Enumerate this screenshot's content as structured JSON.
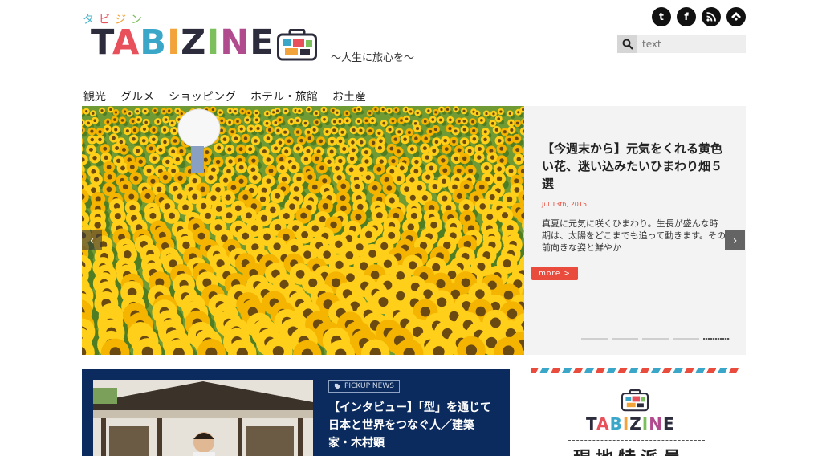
{
  "logo": {
    "kana": [
      "タ",
      "ビ",
      "ジ",
      "ン"
    ],
    "word": [
      "T",
      "A",
      "B",
      "I",
      "Z",
      "I",
      "N",
      "E"
    ],
    "tagline": "〜人生に旅心を〜"
  },
  "social": {
    "twitter_glyph": "t",
    "facebook_glyph": "f",
    "rss_glyph": "r",
    "feedly_glyph": "f"
  },
  "search": {
    "placeholder": "text"
  },
  "nav": [
    "観光",
    "グルメ",
    "ショッピング",
    "ホテル・旅館",
    "お土産"
  ],
  "slider": {
    "title": "【今週末から】元気をくれる黄色い花、迷い込みたいひまわり畑５選",
    "date": "Jul 13th, 2015",
    "excerpt": "真夏に元気に咲くひまわり。生長が盛んな時期は、太陽をどこまでも追って動きます。その前向きな姿と鮮やか",
    "more_label": "more >",
    "prev_glyph": "‹",
    "next_glyph": "›",
    "dot_count": 5,
    "active_dot": 4
  },
  "pickup": {
    "badge": "PICKUP NEWS",
    "title": "【インタビュー】「型」を通じて日本と世界をつなぐ人／建築家・木村顕"
  },
  "reporter": {
    "word": [
      "T",
      "A",
      "B",
      "I",
      "Z",
      "I",
      "N",
      "E"
    ],
    "heading": "現地特派員"
  },
  "colors": {
    "accent_red": "#e94b3c",
    "pickup_navy": "#0b2b5e"
  }
}
